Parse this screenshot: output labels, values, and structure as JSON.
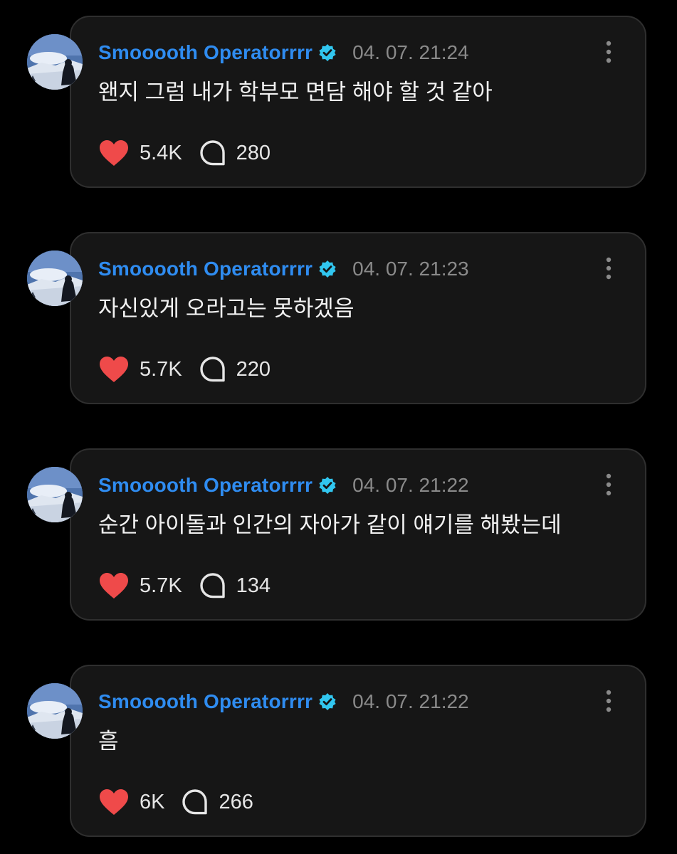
{
  "colors": {
    "background": "#000000",
    "card": "#161616",
    "card_border": "#2f2f2f",
    "username": "#2f8cf0",
    "verified_badge": "#31c6ef",
    "timestamp": "#8a8a8a",
    "heart": "#ef4a4a",
    "text": "#f2f2f2"
  },
  "icons": {
    "like": "heart-icon",
    "reply": "speech-bubble-icon",
    "more": "vertical-ellipsis-icon",
    "verified": "verified-badge-icon"
  },
  "posts": [
    {
      "username": "Smooooth Operatorrrr",
      "timestamp": "04. 07. 21:24",
      "text": "왠지 그럼 내가 학부모 면담 해야 할 것 같아",
      "likes": "5.4K",
      "replies": "280"
    },
    {
      "username": "Smooooth Operatorrrr",
      "timestamp": "04. 07. 21:23",
      "text": "자신있게 오라고는 못하겠음",
      "likes": "5.7K",
      "replies": "220"
    },
    {
      "username": "Smooooth Operatorrrr",
      "timestamp": "04. 07. 21:22",
      "text": "순간 아이돌과 인간의 자아가 같이 얘기를 해봤는데",
      "likes": "5.7K",
      "replies": "134"
    },
    {
      "username": "Smooooth Operatorrrr",
      "timestamp": "04. 07. 21:22",
      "text": "흠",
      "likes": "6K",
      "replies": "266"
    }
  ]
}
